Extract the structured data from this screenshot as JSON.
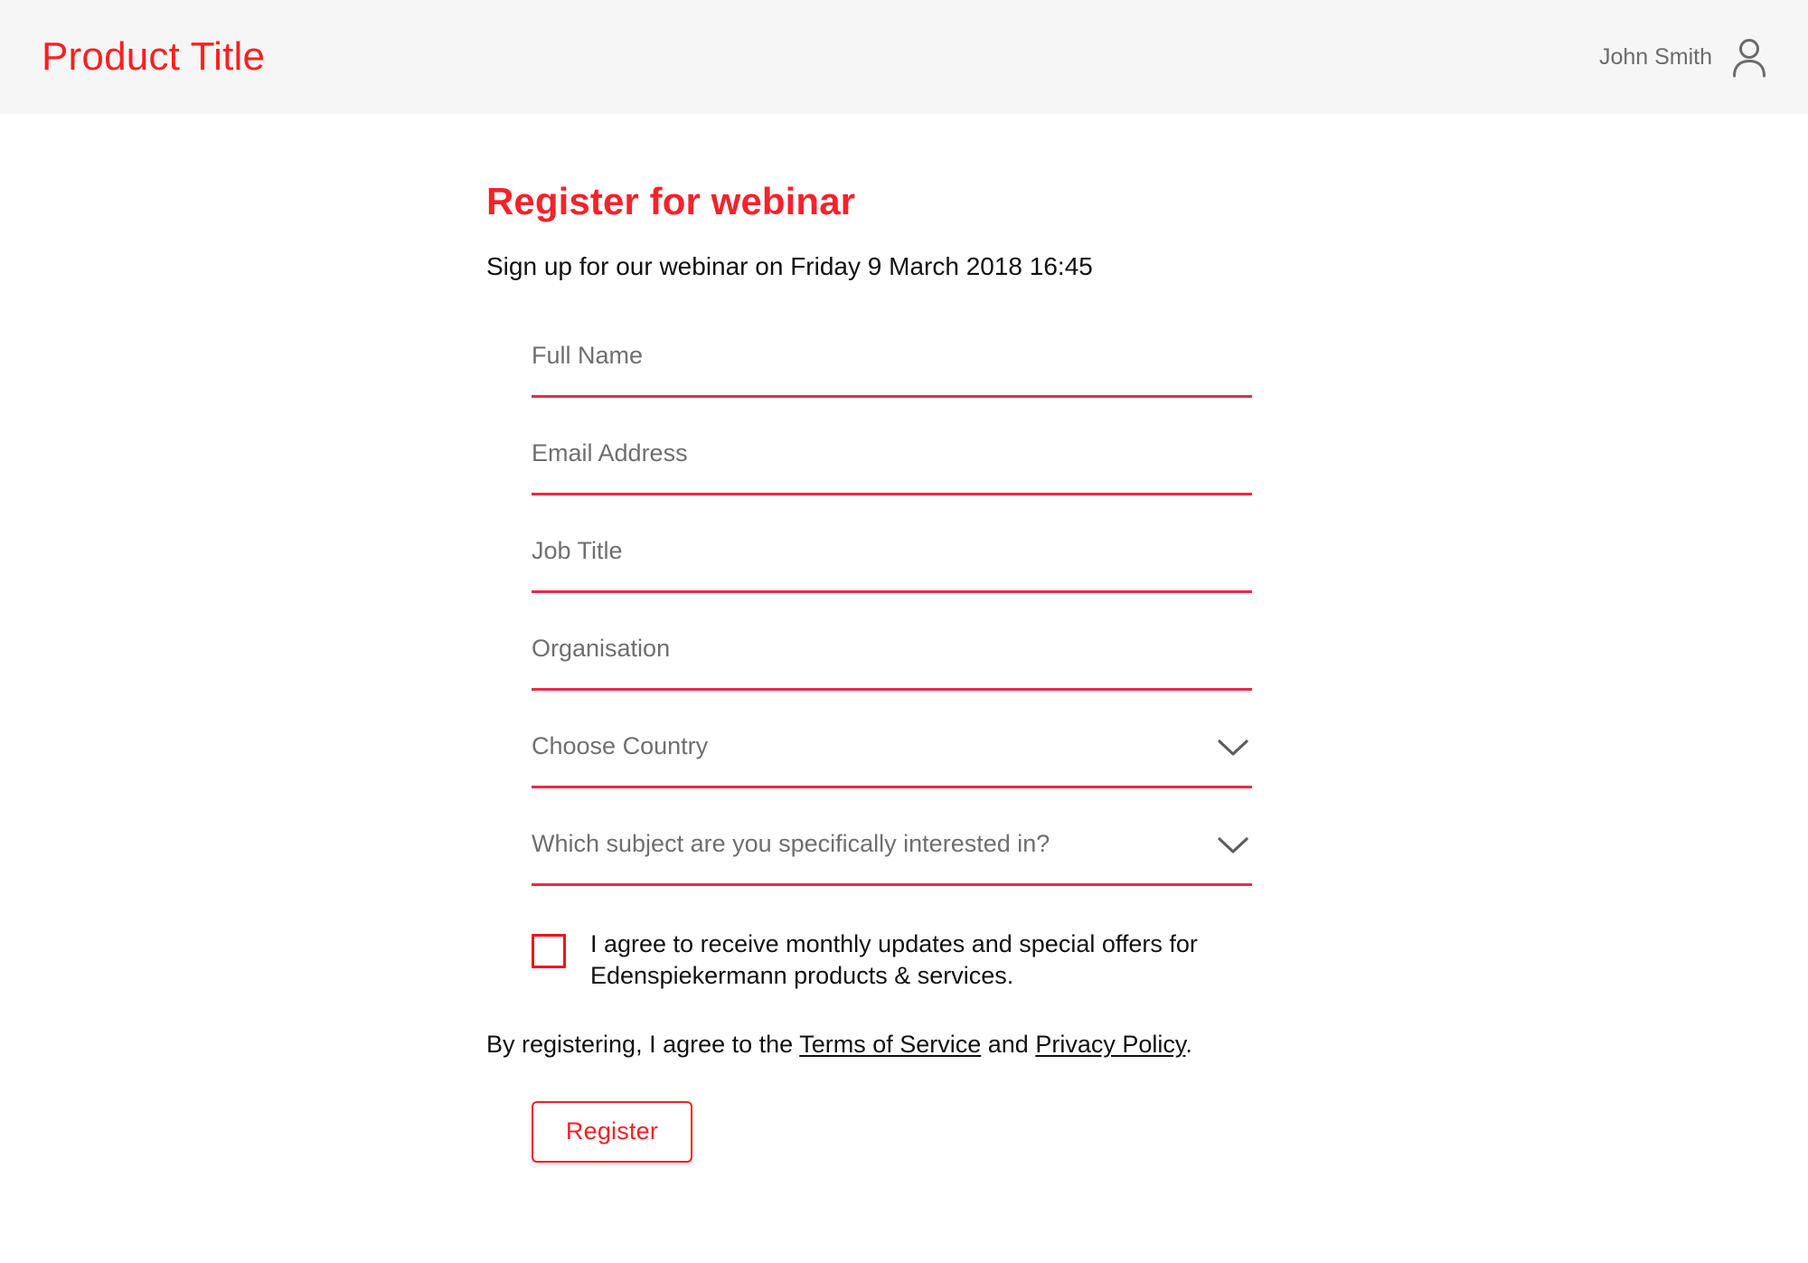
{
  "header": {
    "product_title": "Product Title",
    "user_name": "John Smith",
    "avatar_icon": "user-person-icon",
    "background_color": "#f6f6f6",
    "title_color": "#fa2020"
  },
  "main": {
    "heading": "Register for webinar",
    "heading_color": "#f5222b",
    "subtitle": "Sign up for our webinar on Friday 9 March 2018 16:45",
    "form": {
      "underline_color": "#ee2747",
      "fields": [
        {
          "name": "full-name",
          "placeholder": "Full Name",
          "value": "",
          "type": "text"
        },
        {
          "name": "email",
          "placeholder": "Email Address",
          "value": "",
          "type": "email"
        },
        {
          "name": "job-title",
          "placeholder": "Job Title",
          "value": "",
          "type": "text"
        },
        {
          "name": "organisation",
          "placeholder": "Organisation",
          "value": "",
          "type": "text"
        },
        {
          "name": "country",
          "placeholder": "Choose Country",
          "value": "",
          "type": "select",
          "icon": "chevron-down-icon"
        },
        {
          "name": "subject",
          "placeholder": "Which subject are you specifically interested in?",
          "value": "",
          "type": "select",
          "icon": "chevron-down-icon"
        }
      ],
      "consent": {
        "checked": false,
        "checkbox_color": "#fb0d0d",
        "label": "I agree to receive monthly updates and special offers for Edenspiekermann products & services."
      },
      "terms": {
        "prefix": "By registering, I agree to the ",
        "link_1": "Terms of Service",
        "middle": " and ",
        "link_2": "Privacy Policy",
        "suffix": "."
      },
      "submit_label": "Register",
      "submit_color": "#f71f25"
    }
  }
}
